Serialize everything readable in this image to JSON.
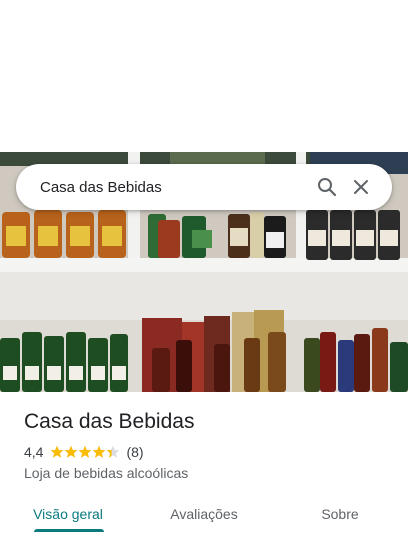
{
  "search": {
    "query": "Casa das Bebidas"
  },
  "place": {
    "name": "Casa das Bebidas",
    "rating": "4,4",
    "stars": 4.4,
    "review_count": "(8)",
    "category": "Loja de bebidas alcoólicas"
  },
  "tabs": [
    {
      "label": "Visão geral",
      "active": true
    },
    {
      "label": "Avaliações",
      "active": false
    },
    {
      "label": "Sobre",
      "active": false
    }
  ],
  "colors": {
    "accent": "#0b7a7e",
    "star": "#fbbc04"
  },
  "icons": {
    "search": "search-icon",
    "close": "close-icon"
  }
}
